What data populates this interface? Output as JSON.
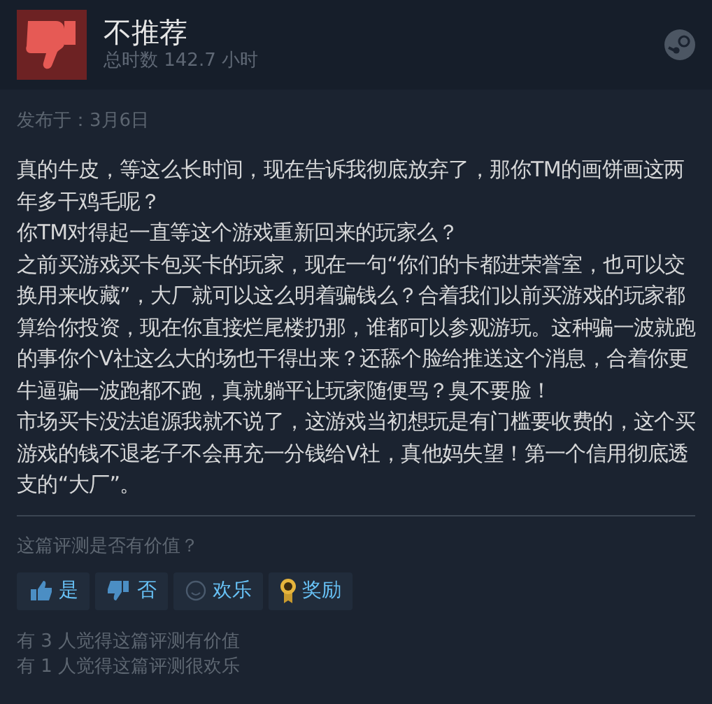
{
  "review": {
    "verdict": "不推荐",
    "hours": "总时数 142.7 小时",
    "posted": "发布于：3月6日",
    "paragraphs": [
      "真的牛皮，等这么长时间，现在告诉我彻底放弃了，那你TM的画饼画这两年多干鸡毛呢？",
      "你TM对得起一直等这个游戏重新回来的玩家么？",
      "之前买游戏买卡包买卡的玩家，现在一句“你们的卡都进荣誉室，也可以交换用来收藏”，大厂就可以这么明着骗钱么？合着我们以前买游戏的玩家都算给你投资，现在你直接烂尾楼扔那，谁都可以参观游玩。这种骗一波就跑的事你个V社这么大的场也干得出来？还舔个脸给推送这个消息，合着你更牛逼骗一波跑都不跑，真就躺平让玩家随便骂？臭不要脸！",
      "市场买卡没法追源我就不说了，这游戏当初想玩是有门槛要收费的，这个买游戏的钱不退老子不会再充一分钱给V社，真他妈失望！第一个信用彻底透支的“大厂”。"
    ]
  },
  "feedback": {
    "question": "这篇评测是否有价值？",
    "buttons": [
      {
        "kind": "yes",
        "label": "是"
      },
      {
        "kind": "no",
        "label": "否"
      },
      {
        "kind": "funny",
        "label": "欢乐"
      },
      {
        "kind": "award",
        "label": "奖励"
      }
    ],
    "stats": [
      "有 3 人觉得这篇评测有价值",
      "有 1 人觉得这篇评测很欢乐"
    ]
  }
}
